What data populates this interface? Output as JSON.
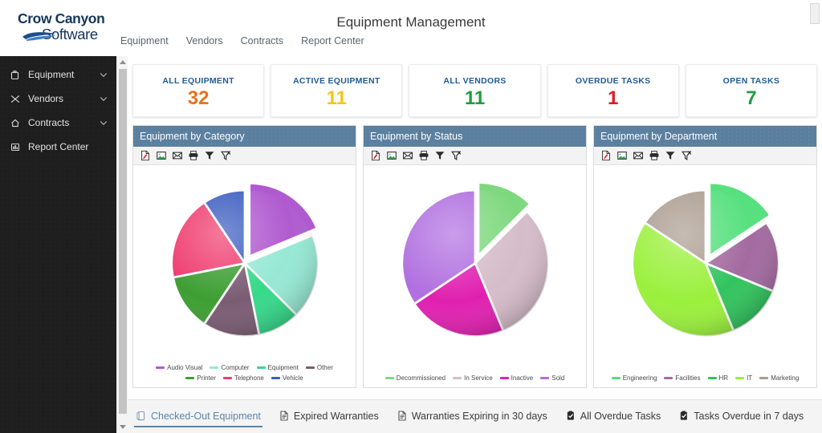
{
  "app": {
    "title": "Equipment Management",
    "logo": {
      "line1": "Crow Canyon",
      "line2": "Software"
    }
  },
  "topnav": {
    "items": [
      {
        "label": "Equipment"
      },
      {
        "label": "Vendors"
      },
      {
        "label": "Contracts"
      },
      {
        "label": "Report Center"
      }
    ]
  },
  "sidebar": {
    "items": [
      {
        "label": "Equipment",
        "icon": "briefcase-icon",
        "expandable": true
      },
      {
        "label": "Vendors",
        "icon": "network-icon",
        "expandable": true
      },
      {
        "label": "Contracts",
        "icon": "home-icon",
        "expandable": true
      },
      {
        "label": "Report Center",
        "icon": "report-icon",
        "expandable": false
      }
    ]
  },
  "kpis": [
    {
      "label": "ALL EQUIPMENT",
      "value": "32",
      "color": "#e8721c"
    },
    {
      "label": "ACTIVE EQUIPMENT",
      "value": "11",
      "color": "#f5c518"
    },
    {
      "label": "ALL VENDORS",
      "value": "11",
      "color": "#1f9e3f"
    },
    {
      "label": "OVERDUE TASKS",
      "value": "1",
      "color": "#e01b24"
    },
    {
      "label": "OPEN TASKS",
      "value": "7",
      "color": "#1f9e3f"
    }
  ],
  "panel_tools": [
    {
      "name": "export-pdf-icon",
      "title": "Export to PDF"
    },
    {
      "name": "export-image-icon",
      "title": "Export as Image"
    },
    {
      "name": "email-icon",
      "title": "Email"
    },
    {
      "name": "print-icon",
      "title": "Print"
    },
    {
      "name": "filter-icon",
      "title": "Filter"
    },
    {
      "name": "clear-filter-icon",
      "title": "Clear Filter"
    }
  ],
  "chart_data": [
    {
      "type": "pie",
      "title": "Equipment by Category",
      "legend_position": "bottom",
      "exploded_index": 0,
      "categories": [
        "Audio Visual",
        "Computer",
        "Equipment",
        "Other",
        "Printer",
        "Telephone",
        "Vehicle"
      ],
      "values": [
        6,
        6,
        3,
        4,
        4,
        6,
        3
      ],
      "colors": [
        "#b05ad0",
        "#96e8d4",
        "#36d98a",
        "#7a5c73",
        "#3d9e32",
        "#ef3b6e",
        "#3a5bbf"
      ]
    },
    {
      "type": "pie",
      "title": "Equipment by Status",
      "legend_position": "bottom",
      "exploded_index": 0,
      "categories": [
        "Decommissioned",
        "In Service",
        "Inactive",
        "Sold"
      ],
      "values": [
        4,
        10,
        7,
        11
      ],
      "colors": [
        "#7ed87e",
        "#d5bcc9",
        "#e020b0",
        "#b06fe0"
      ]
    },
    {
      "type": "pie",
      "title": "Equipment by Department",
      "legend_position": "bottom",
      "exploded_index": 0,
      "categories": [
        "Engineering",
        "Facilities",
        "HR",
        "IT",
        "Marketing"
      ],
      "values": [
        5,
        5,
        4,
        13,
        5
      ],
      "colors": [
        "#56e07e",
        "#a36aa0",
        "#32c45e",
        "#9af03c",
        "#ab9c90"
      ]
    }
  ],
  "tabs": {
    "items": [
      {
        "label": "Checked-Out Equipment",
        "icon": "clipboard-icon",
        "active": true
      },
      {
        "label": "Expired Warranties",
        "icon": "document-icon",
        "active": false
      },
      {
        "label": "Warranties Expiring in 30 days",
        "icon": "document-icon",
        "active": false
      },
      {
        "label": "All Overdue Tasks",
        "icon": "clipboard-check-icon",
        "active": false
      },
      {
        "label": "Tasks Overdue in 7 days",
        "icon": "clipboard-check-icon",
        "active": false
      }
    ]
  }
}
